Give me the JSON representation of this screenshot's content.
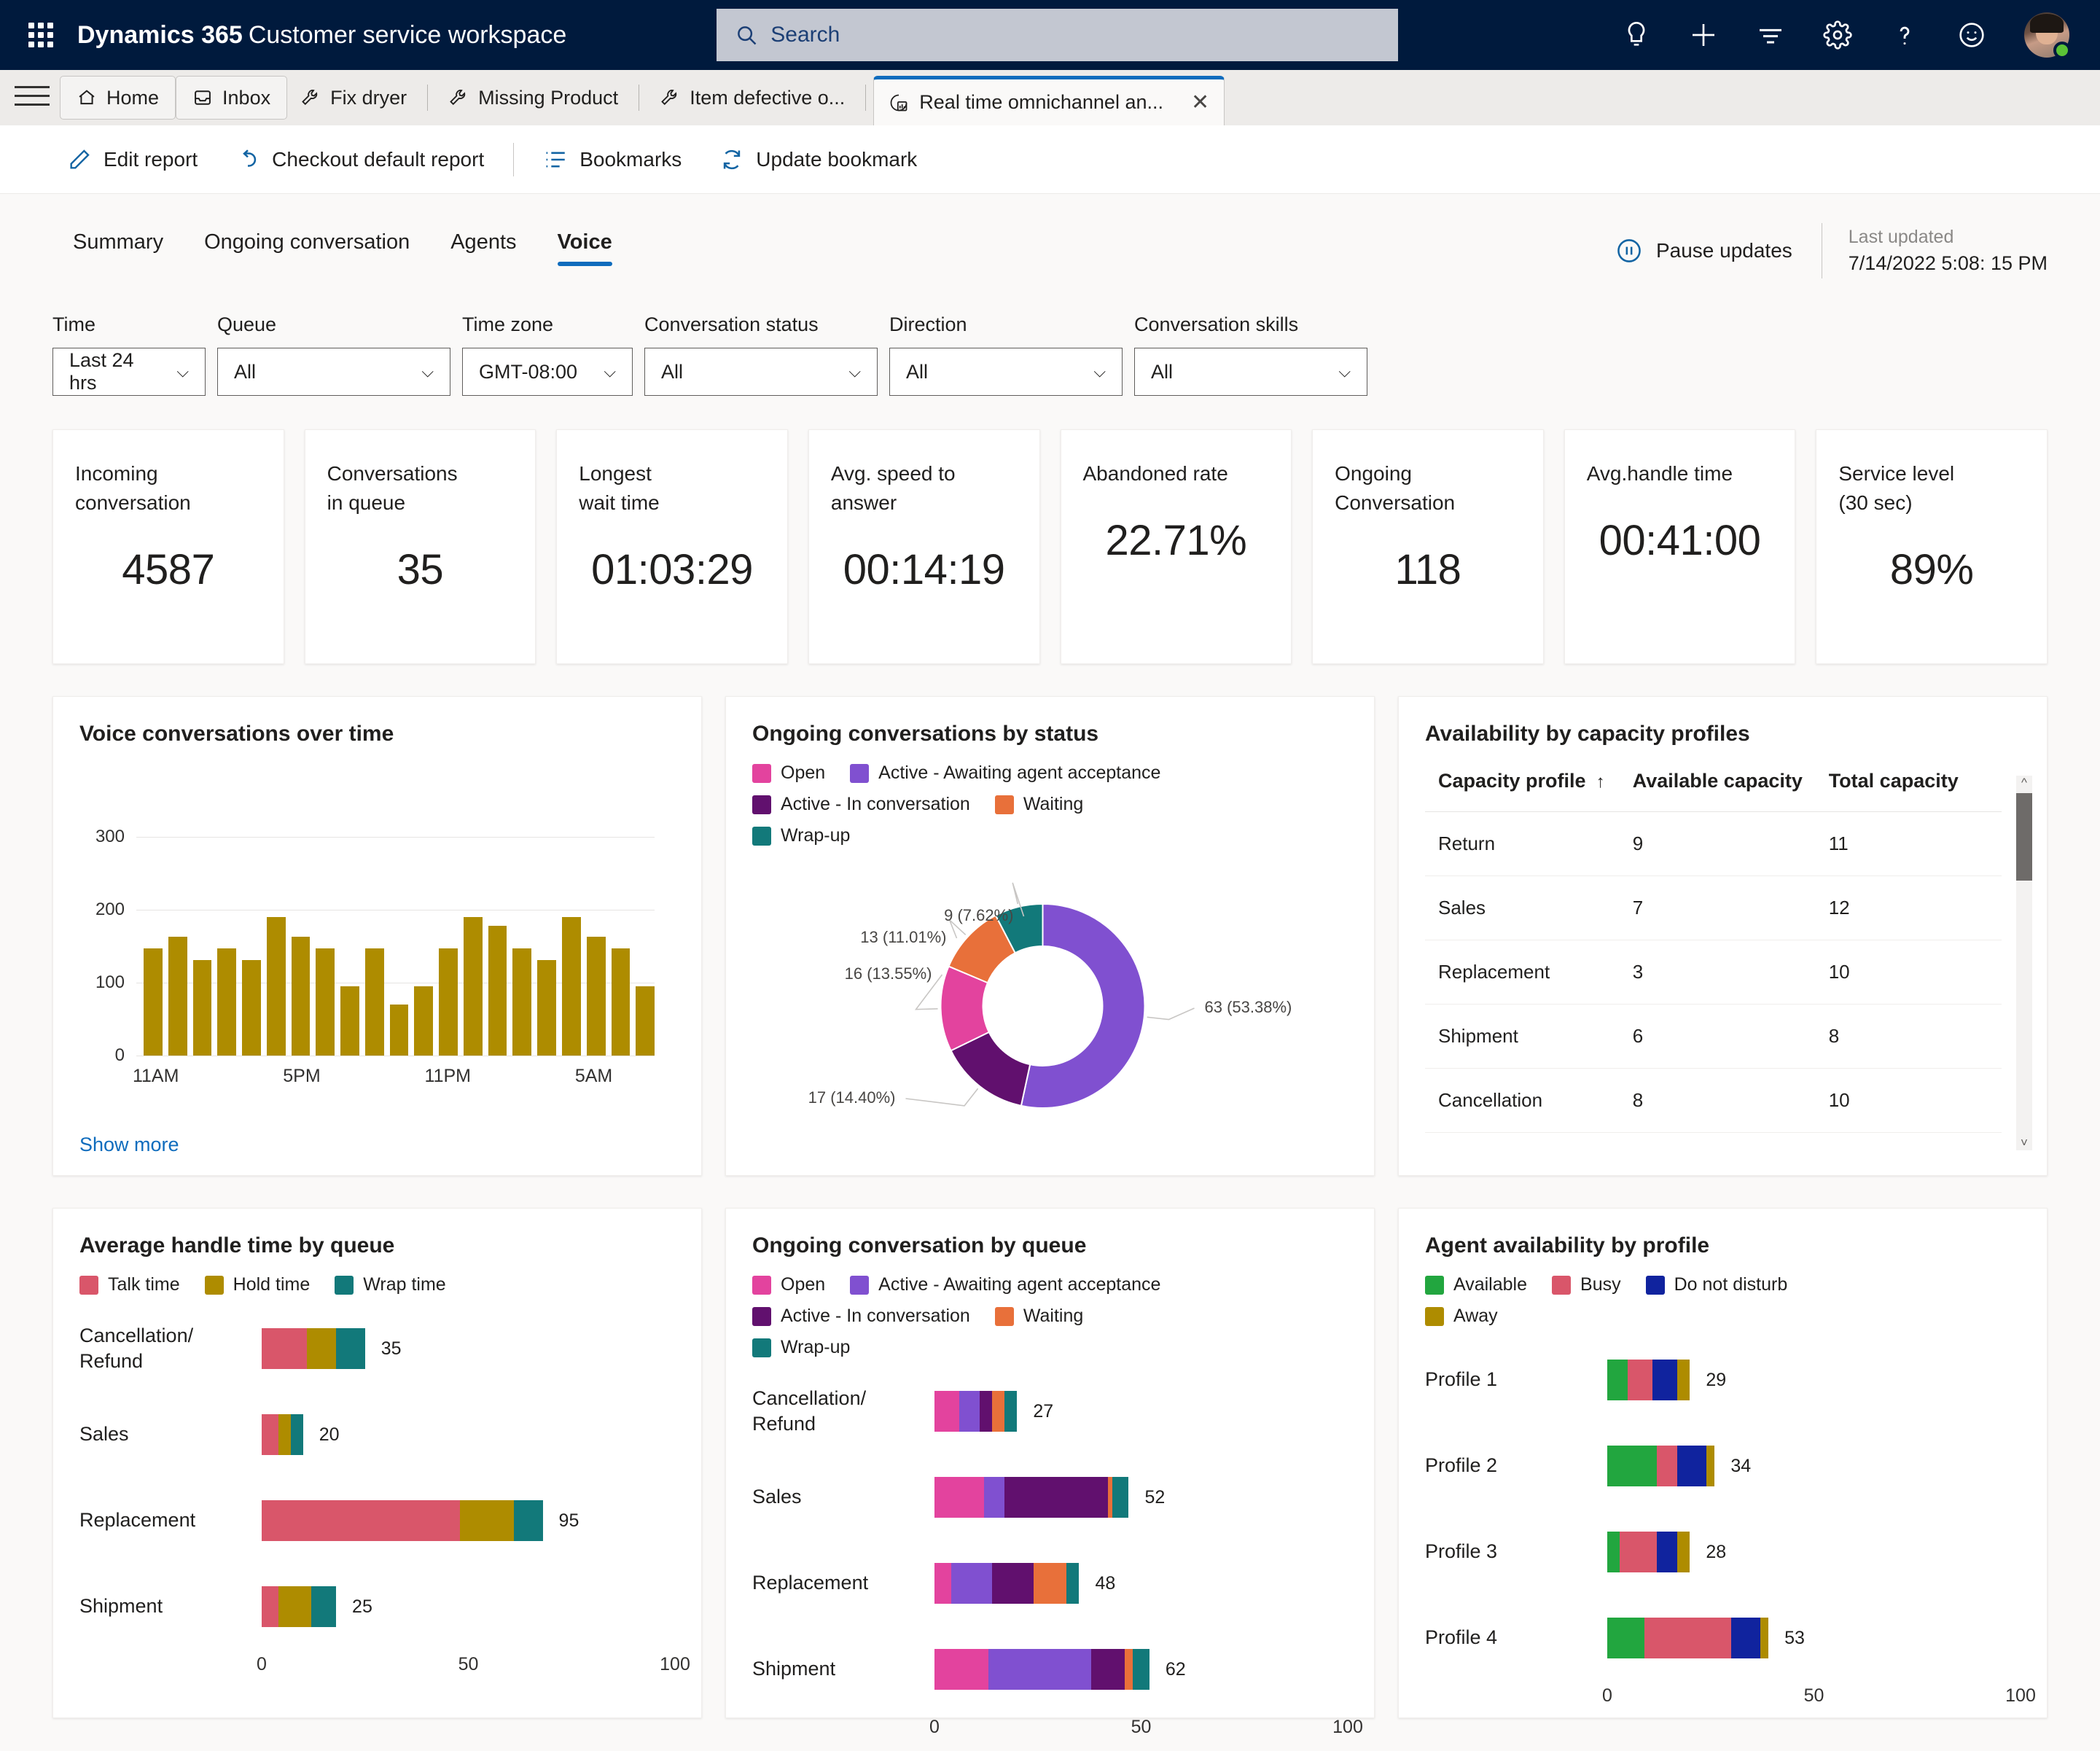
{
  "app": {
    "brand_bold": "Dynamics 365",
    "brand_light": "Customer service workspace",
    "search_placeholder": "Search",
    "nav_icons": [
      "lightbulb-icon",
      "add-icon",
      "filter-list-icon",
      "settings-gear-icon",
      "help-question-icon",
      "smiley-feedback-icon"
    ]
  },
  "tabstrip": {
    "items": [
      {
        "label": "Home",
        "icon": "home-icon",
        "style": "boxed"
      },
      {
        "label": "Inbox",
        "icon": "inbox-icon",
        "style": "boxed"
      },
      {
        "label": "Fix dryer",
        "icon": "wrench-icon",
        "style": "plain"
      },
      {
        "label": "Missing Product",
        "icon": "wrench-icon",
        "style": "plain"
      },
      {
        "label": "Item defective o...",
        "icon": "wrench-icon",
        "style": "plain"
      }
    ],
    "active_tab": {
      "label": "Real time omnichannel an...",
      "icon": "report-chart-icon",
      "close": "✕"
    }
  },
  "commandbar": {
    "edit_report": "Edit report",
    "checkout_default_report": "Checkout default report",
    "bookmarks": "Bookmarks",
    "update_bookmark": "Update bookmark"
  },
  "report_tabs": {
    "items": [
      "Summary",
      "Ongoing conversation",
      "Agents",
      "Voice"
    ],
    "selected": "Voice"
  },
  "status": {
    "pause_label": "Pause updates",
    "last_updated_label": "Last updated",
    "last_updated_value": "7/14/2022 5:08: 15 PM"
  },
  "filters": [
    {
      "label": "Time",
      "value": "Last 24 hrs",
      "width": "w-time"
    },
    {
      "label": "Queue",
      "value": "All",
      "width": "w-std"
    },
    {
      "label": "Time zone",
      "value": "GMT-08:00",
      "width": "w-tz"
    },
    {
      "label": "Conversation status",
      "value": "All",
      "width": "w-std"
    },
    {
      "label": "Direction",
      "value": "All",
      "width": "w-std"
    },
    {
      "label": "Conversation skills",
      "value": "All",
      "width": "w-std"
    }
  ],
  "kpis": [
    {
      "label": "Incoming\nconversation",
      "value": "4587"
    },
    {
      "label": "Conversations\nin queue",
      "value": "35"
    },
    {
      "label": "Longest\nwait time",
      "value": "01:03:29"
    },
    {
      "label": "Avg. speed to\nanswer",
      "value": "00:14:19"
    },
    {
      "label": "Abandoned rate",
      "value": "22.71%"
    },
    {
      "label": "Ongoing\nConversation",
      "value": "118"
    },
    {
      "label": "Avg.handle time",
      "value": "00:41:00"
    },
    {
      "label": "Service level\n(30 sec)",
      "value": "89%"
    }
  ],
  "cards": {
    "voice_over_time_title": "Voice conversations over time",
    "show_more": "Show more",
    "ongoing_status_title": "Ongoing conversations by status",
    "availability_title": "Availability by capacity profiles",
    "avg_handle_title": "Average handle time by queue",
    "ongoing_queue_title": "Ongoing conversation by queue",
    "agent_avail_title": "Agent availability by profile"
  },
  "capacity_table": {
    "headers": [
      "Capacity profile",
      "Available capacity",
      "Total capacity"
    ],
    "sort_indicator": "↑",
    "rows": [
      {
        "profile": "Return",
        "available": "9",
        "total": "11"
      },
      {
        "profile": "Sales",
        "available": "7",
        "total": "12"
      },
      {
        "profile": "Replacement",
        "available": "3",
        "total": "10"
      },
      {
        "profile": "Shipment",
        "available": "6",
        "total": "8"
      },
      {
        "profile": "Cancellation",
        "available": "8",
        "total": "10"
      }
    ]
  },
  "colors": {
    "brand_dark": "#001a3d",
    "accent_blue": "#0f6cbd",
    "gold": "#ae8c00",
    "pink": "#e3439e",
    "purple_light": "#8050d0",
    "purple_dark": "#61106e",
    "orange": "#e8703a",
    "teal": "#12797a",
    "red": "#d9566a",
    "green": "#22a63f",
    "blue_navy": "#10239e"
  },
  "chart_data": [
    {
      "type": "bar",
      "title": "Voice conversations over time",
      "xlabel": "",
      "ylabel": "",
      "ylim": [
        0,
        340
      ],
      "yticks": [
        0,
        100,
        200,
        300
      ],
      "grid": true,
      "color": "#ae8c00",
      "categories": [
        "11AM",
        "12PM",
        "1PM",
        "2PM",
        "3PM",
        "4PM",
        "5PM",
        "6PM",
        "7PM",
        "8PM",
        "9PM",
        "10PM",
        "11PM",
        "12AM",
        "1AM",
        "2AM",
        "3AM",
        "4AM",
        "5AM",
        "6AM",
        "7AM"
      ],
      "tick_labels": [
        "11AM",
        "5PM",
        "11PM",
        "5AM"
      ],
      "tick_positions": [
        0,
        6,
        12,
        18
      ],
      "values": [
        147,
        163,
        131,
        147,
        131,
        190,
        163,
        147,
        95,
        147,
        70,
        95,
        147,
        190,
        178,
        147,
        131,
        190,
        163,
        147,
        95
      ]
    },
    {
      "type": "pie",
      "title": "Ongoing conversations by status",
      "legend_position": "top",
      "labels": [
        "Open",
        "Active - Awaiting agent acceptance",
        "Active - In conversation",
        "Waiting",
        "Wrap-up"
      ],
      "values": [
        16,
        63,
        17,
        13,
        9
      ],
      "percents": [
        "13.55%",
        "53.38%",
        "14.40%",
        "11.01%",
        "7.62%"
      ],
      "data_labels": [
        "16 (13.55%)",
        "63 (53.38%)",
        "17 (14.40%)",
        "13 (11.01%)",
        "9 (7.62%)"
      ],
      "colors": [
        "#e3439e",
        "#8050d0",
        "#61106e",
        "#e8703a",
        "#12797a"
      ]
    },
    {
      "type": "bar",
      "orientation": "horizontal",
      "stacked": true,
      "title": "Average handle time by queue",
      "xlim": [
        0,
        100
      ],
      "xticks": [
        0,
        50,
        100
      ],
      "categories": [
        "Cancellation/\nRefund",
        "Sales",
        "Replacement",
        "Shipment"
      ],
      "totals": [
        35,
        20,
        95,
        25
      ],
      "series": [
        {
          "name": "Talk time",
          "color": "#d9566a",
          "values": [
            11,
            4,
            48,
            4
          ]
        },
        {
          "name": "Hold time",
          "color": "#ae8c00",
          "values": [
            7,
            3,
            13,
            8
          ]
        },
        {
          "name": "Wrap time",
          "color": "#12797a",
          "values": [
            7,
            3,
            7,
            6
          ]
        }
      ]
    },
    {
      "type": "bar",
      "orientation": "horizontal",
      "stacked": true,
      "title": "Ongoing conversation by queue",
      "xlim": [
        0,
        100
      ],
      "xticks": [
        0,
        50,
        100
      ],
      "categories": [
        "Cancellation/\nRefund",
        "Sales",
        "Replacement",
        "Shipment"
      ],
      "totals": [
        27,
        52,
        48,
        62
      ],
      "series": [
        {
          "name": "Open",
          "color": "#e3439e",
          "values": [
            6,
            12,
            4,
            13
          ]
        },
        {
          "name": "Active - Awaiting agent acceptance",
          "color": "#8050d0",
          "values": [
            5,
            5,
            10,
            25
          ]
        },
        {
          "name": "Active - In conversation",
          "color": "#61106e",
          "values": [
            3,
            25,
            10,
            8
          ]
        },
        {
          "name": "Waiting",
          "color": "#e8703a",
          "values": [
            3,
            1,
            8,
            2
          ]
        },
        {
          "name": "Wrap-up",
          "color": "#12797a",
          "values": [
            3,
            4,
            3,
            4
          ]
        }
      ]
    },
    {
      "type": "bar",
      "orientation": "horizontal",
      "stacked": true,
      "title": "Agent availability by profile",
      "xlim": [
        0,
        100
      ],
      "xticks": [
        0,
        50,
        100
      ],
      "categories": [
        "Profile 1",
        "Profile 2",
        "Profile 3",
        "Profile 4"
      ],
      "totals": [
        29,
        34,
        28,
        53
      ],
      "series": [
        {
          "name": "Available",
          "color": "#22a63f",
          "values": [
            5,
            12,
            3,
            9
          ]
        },
        {
          "name": "Busy",
          "color": "#d9566a",
          "values": [
            6,
            5,
            9,
            21
          ]
        },
        {
          "name": "Do not disturb",
          "color": "#10239e",
          "values": [
            6,
            7,
            5,
            7
          ]
        },
        {
          "name": "Away",
          "color": "#ae8c00",
          "values": [
            3,
            2,
            3,
            2
          ]
        }
      ]
    }
  ]
}
